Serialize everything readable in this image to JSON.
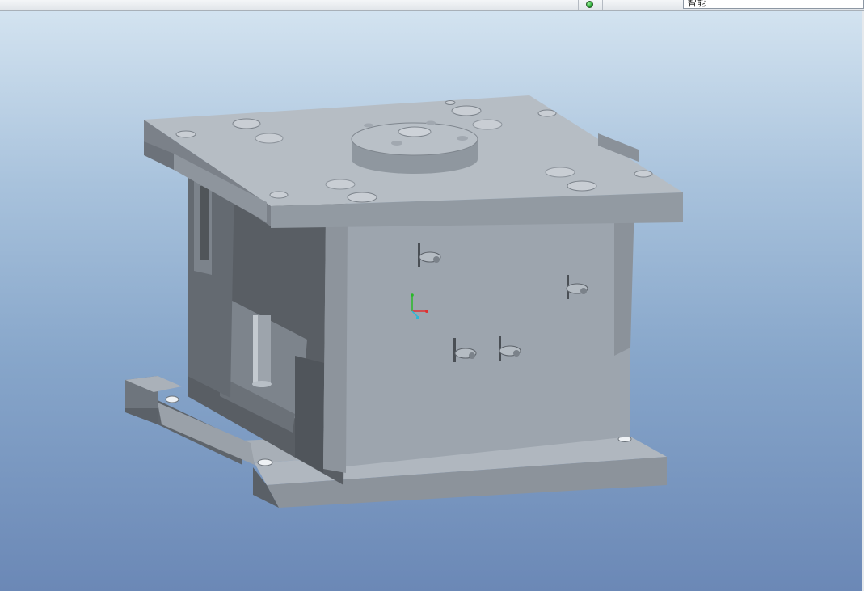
{
  "toolbar": {
    "status_indicator": "green-status-light",
    "selection_filter": {
      "value": "智能"
    }
  },
  "viewport": {
    "background_top": "#d3e3f0",
    "background_bottom": "#6b88b6",
    "model_color": "#9aa2ab",
    "axis_colors": {
      "x": "#e03030",
      "y": "#28b828",
      "z": "#2ab8d8"
    }
  }
}
